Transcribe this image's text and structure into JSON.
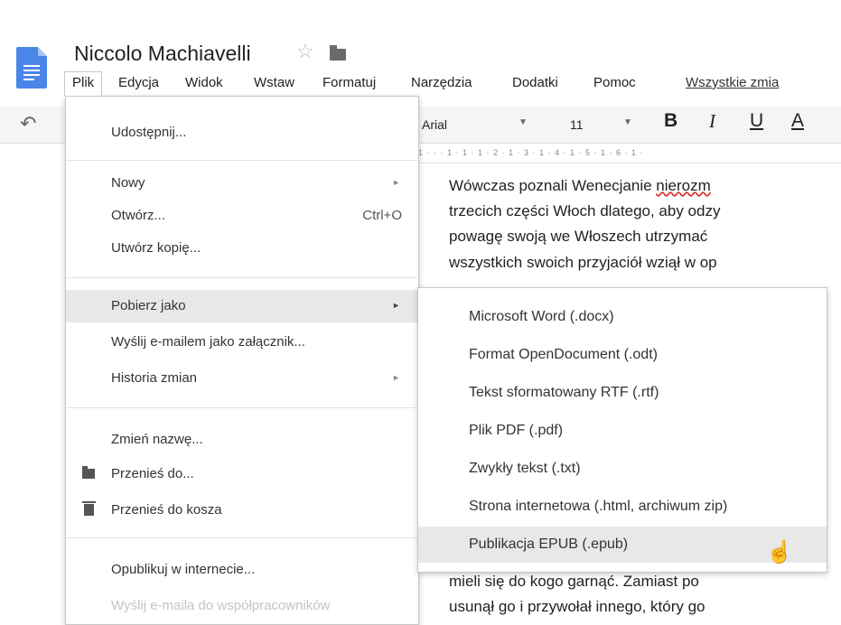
{
  "doc": {
    "title": "Niccolo Machiavelli",
    "lines": [
      [
        "Wówczas poznali Wenecjanie ",
        "nierozm"
      ],
      [
        "trzecich części Włoch dlatego, aby odzy"
      ],
      [
        "powagę swoją we Włoszech utrzymać"
      ],
      [
        "wszystkich swoich przyjaciół wziął w op"
      ],
      [
        "mieli się do kogo garnąć. Zamiast po"
      ],
      [
        "usunął go i przywołał innego, który go"
      ]
    ]
  },
  "menubar": [
    "Plik",
    "Edycja",
    "Widok",
    "Wstaw",
    "Formatuj",
    "Narzędzia",
    "Dodatki",
    "Pomoc"
  ],
  "menubar_link": "Wszystkie zmia",
  "toolbar": {
    "font": "Arial",
    "size": "11",
    "bold": "B",
    "italic": "I",
    "underline": "U",
    "color": "A"
  },
  "ruler": "1 · · · 1 · 1 · 1 · 2 · 1 · 3 · 1 · 4 · 1 · 5 · 1 · 6 · 1 ·",
  "plik_menu": {
    "share": "Udostępnij...",
    "new": "Nowy",
    "open": "Otwórz...",
    "open_shortcut": "Ctrl+O",
    "copy": "Utwórz kopię...",
    "download": "Pobierz jako",
    "email": "Wyślij e-mailem jako załącznik...",
    "history": "Historia zmian",
    "rename": "Zmień nazwę...",
    "move": "Przenieś do...",
    "trash": "Przenieś do kosza",
    "publish": "Opublikuj w internecie...",
    "email_collab": "Wyślij e-maila do współpracowników"
  },
  "download_submenu": [
    "Microsoft Word (.docx)",
    "Format OpenDocument (.odt)",
    "Tekst sformatowany RTF (.rtf)",
    "Plik PDF (.pdf)",
    "Zwykły tekst (.txt)",
    "Strona internetowa (.html, archiwum zip)",
    "Publikacja EPUB (.epub)"
  ],
  "colors": {
    "doc_icon": "#4a86e8",
    "highlight": "#e8e8e8",
    "spellcheck": "#d93025"
  }
}
